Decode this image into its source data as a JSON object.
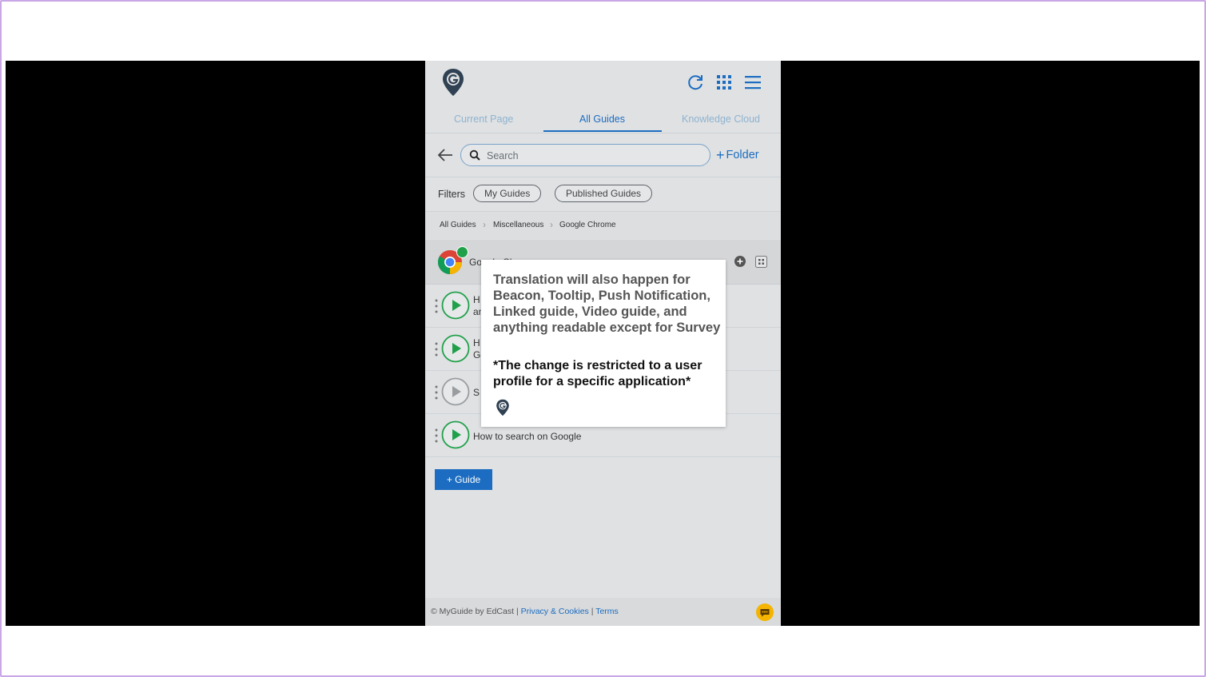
{
  "header": {
    "logo_letter": "G"
  },
  "tabs": [
    {
      "label": "Current Page",
      "active": false
    },
    {
      "label": "All Guides",
      "active": true
    },
    {
      "label": "Knowledge Cloud",
      "active": false
    }
  ],
  "search": {
    "placeholder": "Search",
    "value": ""
  },
  "folder_button": {
    "label": "Folder"
  },
  "filters": {
    "label": "Filters",
    "options": [
      "My Guides",
      "Published Guides"
    ]
  },
  "breadcrumb": [
    "All Guides",
    "Miscellaneous",
    "Google Chrome"
  ],
  "folder": {
    "title": "Google Chrome"
  },
  "guides": [
    {
      "line1": "H",
      "line2": "an",
      "enabled": true
    },
    {
      "line1": "H",
      "line2": "G",
      "enabled": true
    },
    {
      "line1": "S",
      "line2": "",
      "enabled": false
    },
    {
      "line1": "How to search on Google",
      "line2": "",
      "enabled": true
    }
  ],
  "add_guide": {
    "label": "+ Guide"
  },
  "footer": {
    "copyright": "© MyGuide by EdCast",
    "sep": "|",
    "privacy": "Privacy & Cookies",
    "terms": "Terms"
  },
  "tooltip": {
    "main": "Translation will also happen for Beacon, Tooltip, Push Notification, Linked guide, Video guide, and anything readable except for Survey",
    "note": "*The change is restricted to a user profile for a specific application*"
  },
  "colors": {
    "accent": "#1c6dc1",
    "play_green": "#21a04a",
    "frame": "#c9a6e6",
    "chat_yellow": "#f5b400"
  }
}
